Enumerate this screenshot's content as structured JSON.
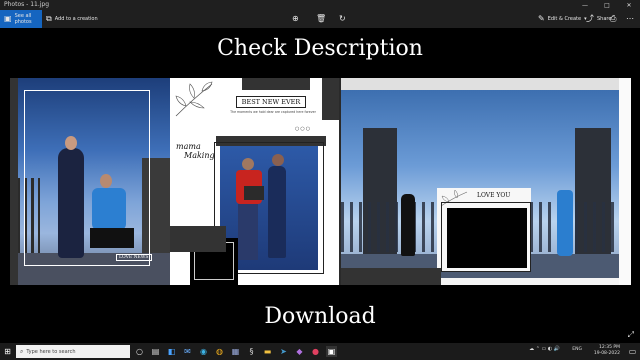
{
  "window": {
    "title": "Photos - 11.jpg",
    "controls": [
      "—",
      "□",
      "✕"
    ]
  },
  "toolbar": {
    "see_all_photos": "See all photos",
    "add_to_creation": "Add to a creation",
    "edit_create": "Edit & Create",
    "share": "Share"
  },
  "content": {
    "heading": "Check Description",
    "footer": "Download",
    "album": {
      "left_badge": "LOVE NEWS",
      "mid_title": "BEST NEW EVER",
      "mid_caption": "The moments we hold dear are captured here forever",
      "mama_line1": "mama",
      "mama_line2": "Making",
      "right_label": "LOVE YOU"
    }
  },
  "taskbar": {
    "search_placeholder": "Type here to search",
    "time": "12:35 PM",
    "date": "19-08-2022",
    "lang": "ENG"
  },
  "colors": {
    "accent": "#1565c0",
    "chrome": "#1f1f1f"
  }
}
